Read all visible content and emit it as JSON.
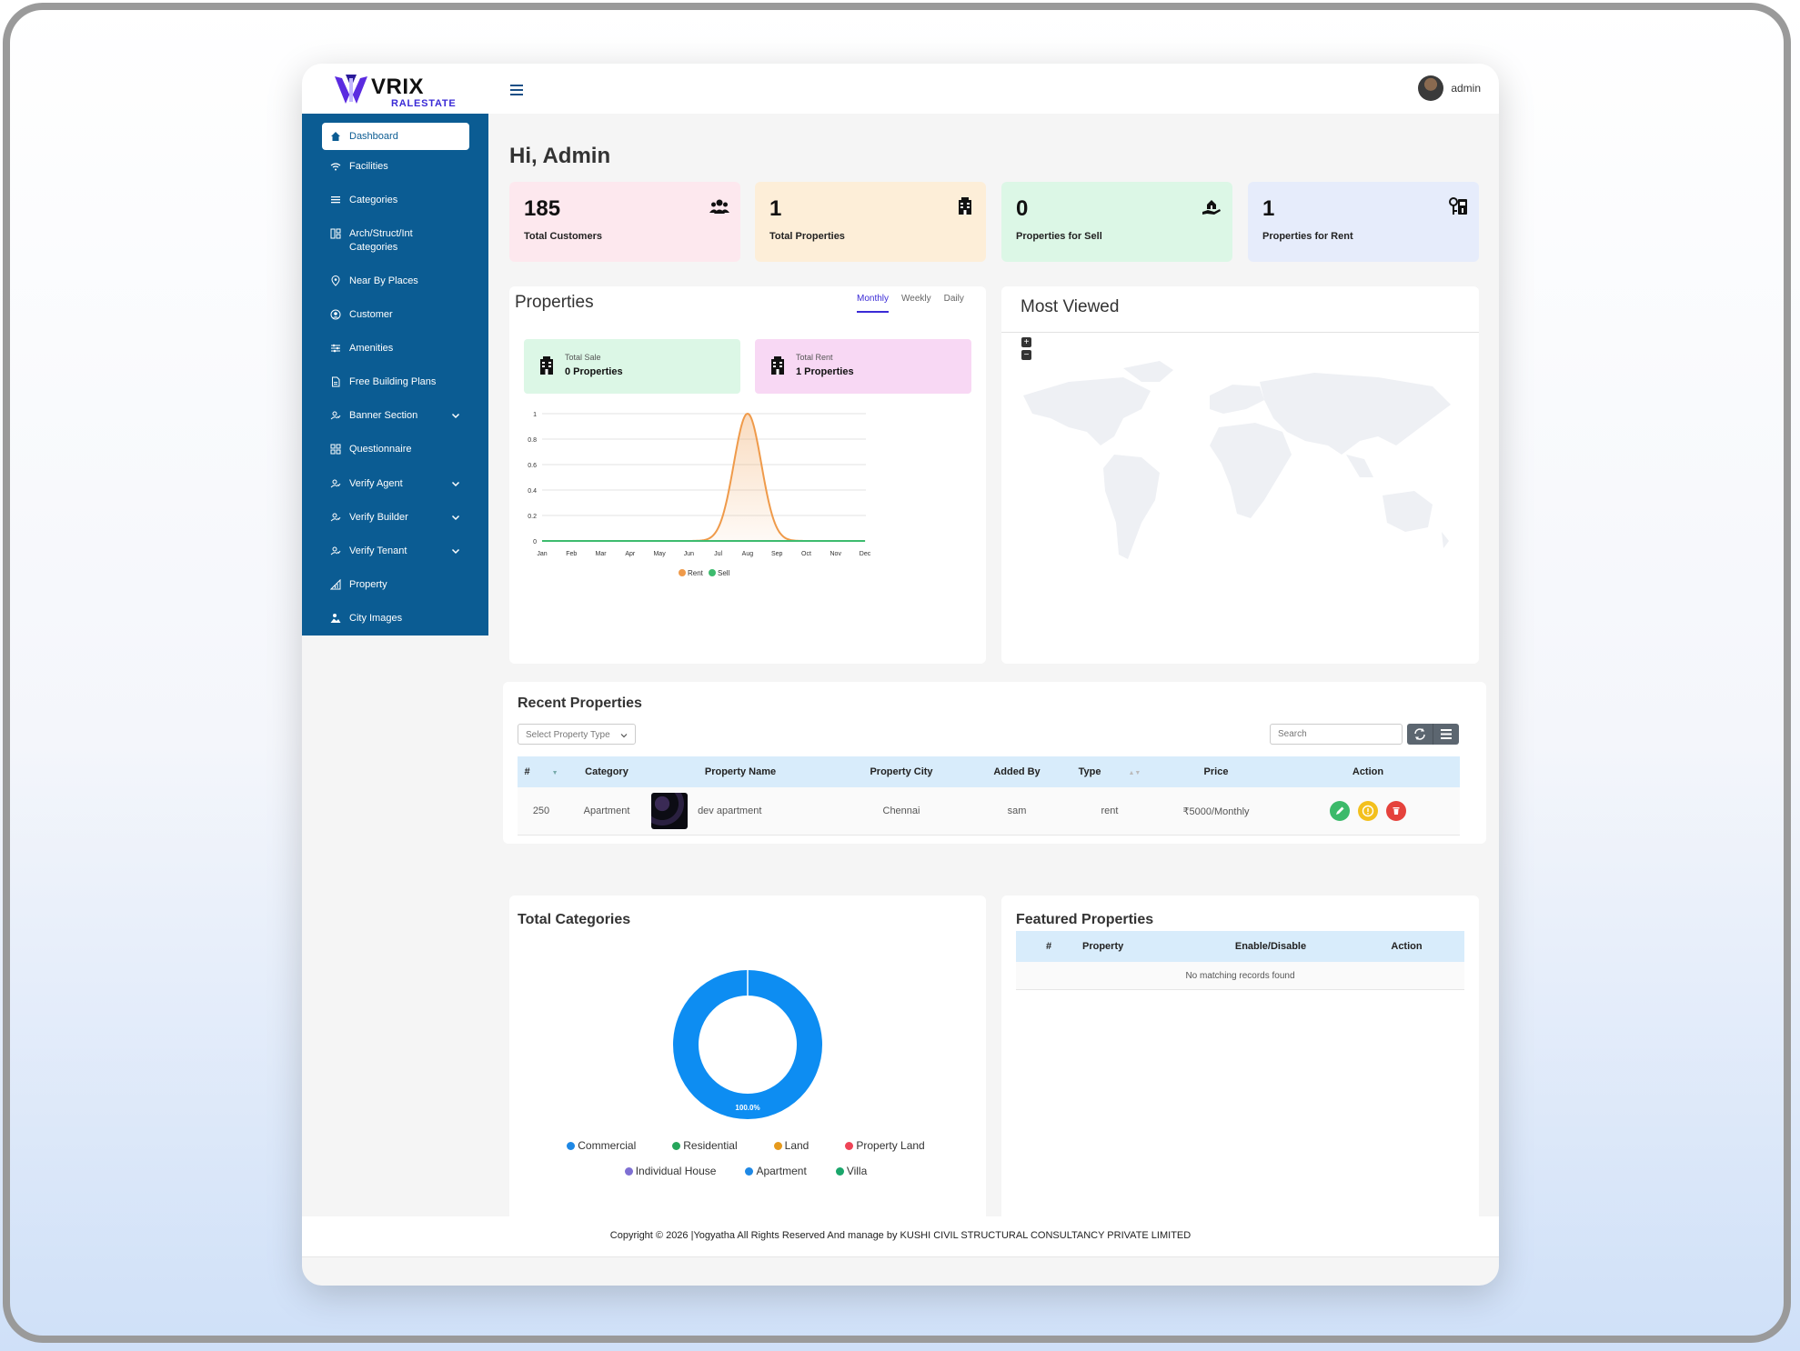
{
  "app": {
    "brand": "VRIX",
    "brand_sub": "RALESTATE",
    "user": "admin"
  },
  "sidebar": {
    "items": [
      {
        "label": "Dashboard",
        "icon": "home-icon"
      },
      {
        "label": "Facilities",
        "icon": "wifi-icon"
      },
      {
        "label": "Categories",
        "icon": "list-icon"
      },
      {
        "label": "Arch/Struct/Int Categories",
        "icon": "grid-icon"
      },
      {
        "label": "Near By Places",
        "icon": "location-pin-icon"
      },
      {
        "label": "Customer",
        "icon": "user-circle-icon"
      },
      {
        "label": "Amenities",
        "icon": "sliders-icon"
      },
      {
        "label": "Free Building Plans",
        "icon": "document-icon"
      },
      {
        "label": "Banner Section",
        "icon": "user-check-icon"
      },
      {
        "label": "Questionnaire",
        "icon": "grid-icon"
      },
      {
        "label": "Verify Agent",
        "icon": "user-check-icon"
      },
      {
        "label": "Verify Builder",
        "icon": "user-check-icon"
      },
      {
        "label": "Verify Tenant",
        "icon": "user-check-icon"
      },
      {
        "label": "Property",
        "icon": "bar-chart-icon"
      },
      {
        "label": "City Images",
        "icon": "image-icon"
      }
    ]
  },
  "main": {
    "greeting": "Hi, Admin",
    "stats": [
      {
        "value": "185",
        "label": "Total Customers",
        "icon": "users-icon",
        "color": "#fde8ee"
      },
      {
        "value": "1",
        "label": "Total Properties",
        "icon": "building-icon",
        "color": "#fdeed8"
      },
      {
        "value": "0",
        "label": "Properties for Sell",
        "icon": "hand-house-icon",
        "color": "#dcf7e6"
      },
      {
        "value": "1",
        "label": "Properties for Rent",
        "icon": "key-icon",
        "color": "#e6ecfb"
      }
    ]
  },
  "properties_card": {
    "title": "Properties",
    "tabs": [
      "Monthly",
      "Weekly",
      "Daily"
    ],
    "active_tab": "Monthly",
    "sale_label": "Total Sale",
    "sale_value": "0 Properties",
    "rent_label": "Total Rent",
    "rent_value": "1 Properties"
  },
  "chart_data": {
    "type": "area",
    "categories": [
      "Jan",
      "Feb",
      "Mar",
      "Apr",
      "May",
      "Jun",
      "Jul",
      "Aug",
      "Sep",
      "Oct",
      "Nov",
      "Dec"
    ],
    "series": [
      {
        "name": "Rent",
        "values": [
          0,
          0,
          0,
          0,
          0,
          0,
          0,
          1,
          0,
          0,
          0,
          0
        ],
        "color": "#ef9a4a"
      },
      {
        "name": "Sell",
        "values": [
          0,
          0,
          0,
          0,
          0,
          0,
          0,
          0,
          0,
          0,
          0,
          0
        ],
        "color": "#3dbb6e"
      }
    ],
    "ylim": [
      0,
      1
    ],
    "yticks": [
      "0",
      "0.2",
      "0.4",
      "0.6",
      "0.8",
      "1"
    ],
    "grid": true,
    "legend": "bottom"
  },
  "most_viewed": {
    "title": "Most Viewed",
    "zoom_in": "+",
    "zoom_out": "−"
  },
  "recent": {
    "title": "Recent Properties",
    "filter_placeholder": "Select Property Type",
    "search_placeholder": "Search",
    "columns": [
      "#",
      "Category",
      "Property Name",
      "Property City",
      "Added By",
      "Type",
      "Price",
      "Action"
    ],
    "rows": [
      {
        "id": "250",
        "category": "Apartment",
        "name": "dev apartment",
        "city": "Chennai",
        "added_by": "sam",
        "type": "rent",
        "price": "₹5000/Monthly"
      }
    ]
  },
  "categories_card": {
    "title": "Total Categories",
    "donut_label": "100.0%",
    "legend": [
      {
        "name": "Commercial",
        "color": "#1e88e5"
      },
      {
        "name": "Residential",
        "color": "#26a65b"
      },
      {
        "name": "Land",
        "color": "#e69a1c"
      },
      {
        "name": "Property Land",
        "color": "#ef4457"
      },
      {
        "name": "Individual House",
        "color": "#7e6fd3"
      },
      {
        "name": "Apartment",
        "color": "#1e88e5"
      },
      {
        "name": "Villa",
        "color": "#1aa66b"
      }
    ]
  },
  "featured": {
    "title": "Featured Properties",
    "columns": [
      "#",
      "Property",
      "Enable/Disable",
      "Action"
    ],
    "empty": "No matching records found"
  },
  "footer": {
    "text": "Copyright © 2026 |Yogyatha All Rights Reserved And manage by KUSHI CIVIL STRUCTURAL CONSULTANCY PRIVATE LIMITED"
  }
}
